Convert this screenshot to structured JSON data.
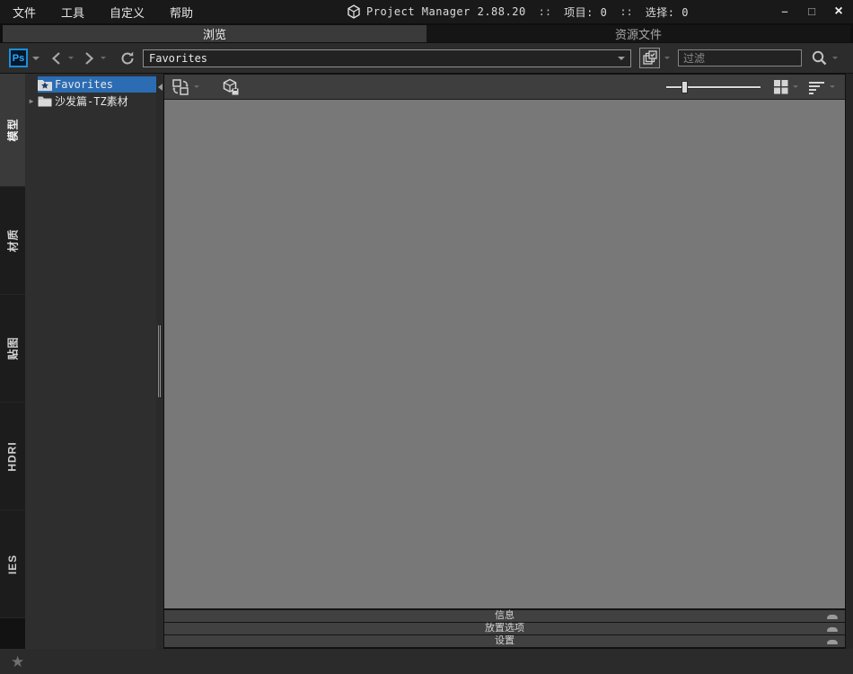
{
  "menubar": {
    "items": [
      {
        "label": "文件"
      },
      {
        "label": "工具"
      },
      {
        "label": "自定义"
      },
      {
        "label": "帮助"
      }
    ]
  },
  "window": {
    "title": "Project Manager 2.88.20",
    "sep1": "::",
    "project_label": "项目: 0",
    "sep2": "::",
    "selection_label": "选择: 0",
    "minimize_glyph": "–",
    "maximize_glyph": "□",
    "close_glyph": "×"
  },
  "page_tabs": [
    {
      "label": "浏览",
      "active": true
    },
    {
      "label": "资源文件",
      "active": false
    }
  ],
  "toolbar": {
    "ps_label": "Ps",
    "address_value": "Favorites",
    "filter_placeholder": "过滤"
  },
  "side_tabs": [
    {
      "label": "模型",
      "active": true
    },
    {
      "label": "材质",
      "active": false
    },
    {
      "label": "贴图",
      "active": false
    },
    {
      "label": "HDRI",
      "active": false
    },
    {
      "label": "IES",
      "active": false
    }
  ],
  "tree": {
    "expander_glyph": "▶",
    "items": [
      {
        "label": "Favorites",
        "selected": true
      },
      {
        "label": "沙发篇-TZ素材",
        "selected": false
      }
    ]
  },
  "rollouts": [
    {
      "label": "信息"
    },
    {
      "label": "放置选项"
    },
    {
      "label": "设置"
    }
  ],
  "statusbar": {
    "star_glyph": "★"
  },
  "colors": {
    "selection_blue": "#2b6cb3",
    "ps_blue": "#31a8ff",
    "canvas_gray": "#787878",
    "panel_dark": "#2e2e2e"
  }
}
